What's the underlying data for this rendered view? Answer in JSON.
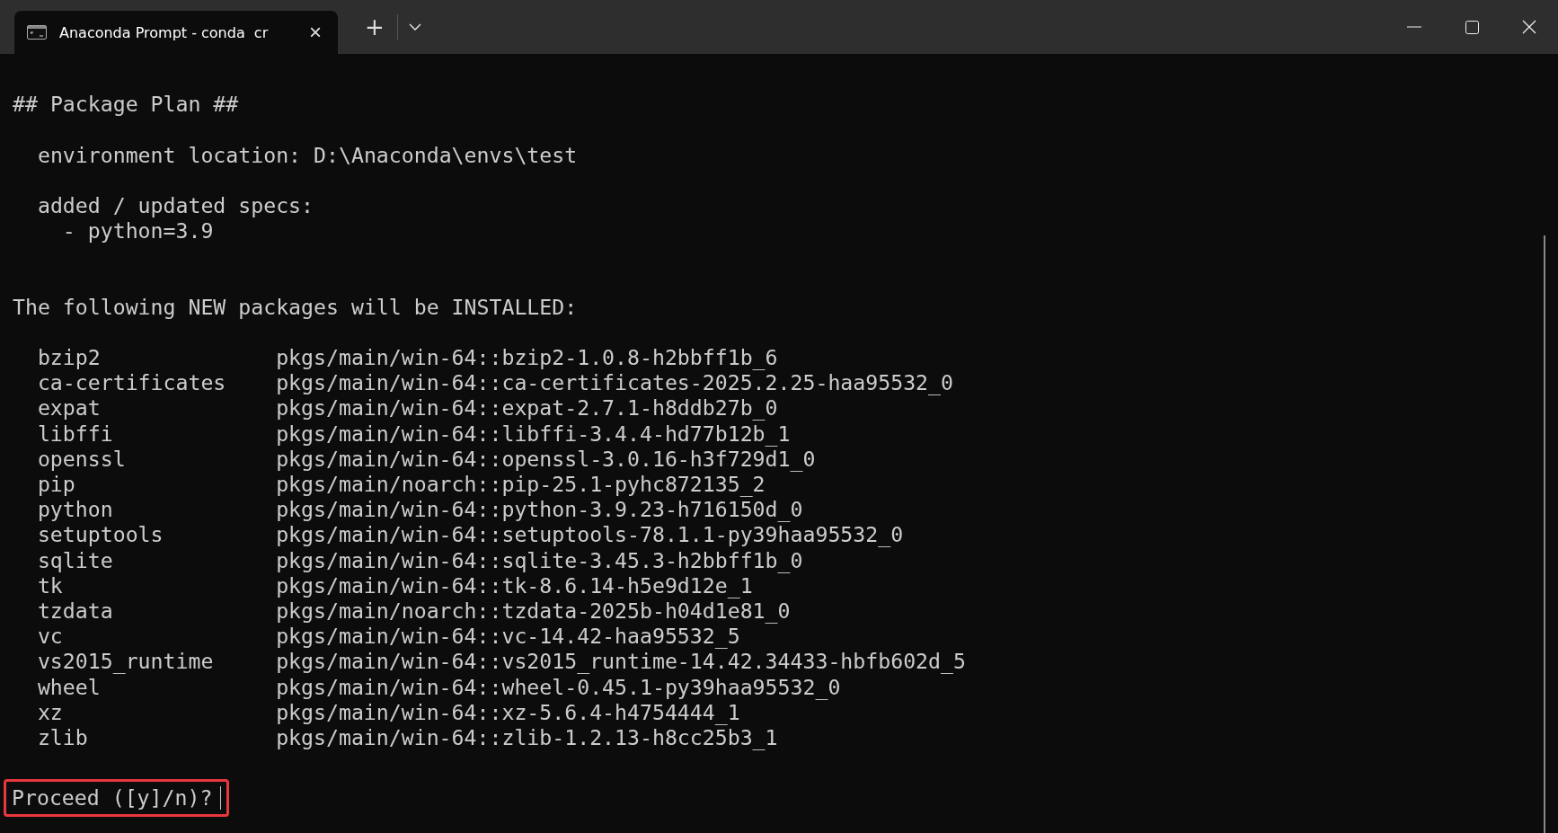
{
  "tab": {
    "title": "Anaconda Prompt - conda  cr",
    "selected": true,
    "close": "×"
  },
  "new_tab": "+",
  "terminal": {
    "header": "## Package Plan ##",
    "location": "  environment location: D:\\Anaconda\\envs\\test",
    "specs_label": "  added / updated specs:",
    "specs": [
      "    - python=3.9"
    ],
    "install_heading": "The following NEW packages will be INSTALLED:",
    "packages": [
      {
        "name": "bzip2",
        "spec": "pkgs/main/win-64::bzip2-1.0.8-h2bbff1b_6"
      },
      {
        "name": "ca-certificates",
        "spec": "pkgs/main/win-64::ca-certificates-2025.2.25-haa95532_0"
      },
      {
        "name": "expat",
        "spec": "pkgs/main/win-64::expat-2.7.1-h8ddb27b_0"
      },
      {
        "name": "libffi",
        "spec": "pkgs/main/win-64::libffi-3.4.4-hd77b12b_1"
      },
      {
        "name": "openssl",
        "spec": "pkgs/main/win-64::openssl-3.0.16-h3f729d1_0"
      },
      {
        "name": "pip",
        "spec": "pkgs/main/noarch::pip-25.1-pyhc872135_2"
      },
      {
        "name": "python",
        "spec": "pkgs/main/win-64::python-3.9.23-h716150d_0"
      },
      {
        "name": "setuptools",
        "spec": "pkgs/main/win-64::setuptools-78.1.1-py39haa95532_0"
      },
      {
        "name": "sqlite",
        "spec": "pkgs/main/win-64::sqlite-3.45.3-h2bbff1b_0"
      },
      {
        "name": "tk",
        "spec": "pkgs/main/win-64::tk-8.6.14-h5e9d12e_1"
      },
      {
        "name": "tzdata",
        "spec": "pkgs/main/noarch::tzdata-2025b-h04d1e81_0"
      },
      {
        "name": "vc",
        "spec": "pkgs/main/win-64::vc-14.42-haa95532_5"
      },
      {
        "name": "vs2015_runtime",
        "spec": "pkgs/main/win-64::vs2015_runtime-14.42.34433-hbfb602d_5"
      },
      {
        "name": "wheel",
        "spec": "pkgs/main/win-64::wheel-0.45.1-py39haa95532_0"
      },
      {
        "name": "xz",
        "spec": "pkgs/main/win-64::xz-5.6.4-h4754444_1"
      },
      {
        "name": "zlib",
        "spec": "pkgs/main/win-64::zlib-1.2.13-h8cc25b3_1"
      }
    ],
    "prompt": "Proceed ([y]/n)?",
    "prompt_highlighted": true
  }
}
